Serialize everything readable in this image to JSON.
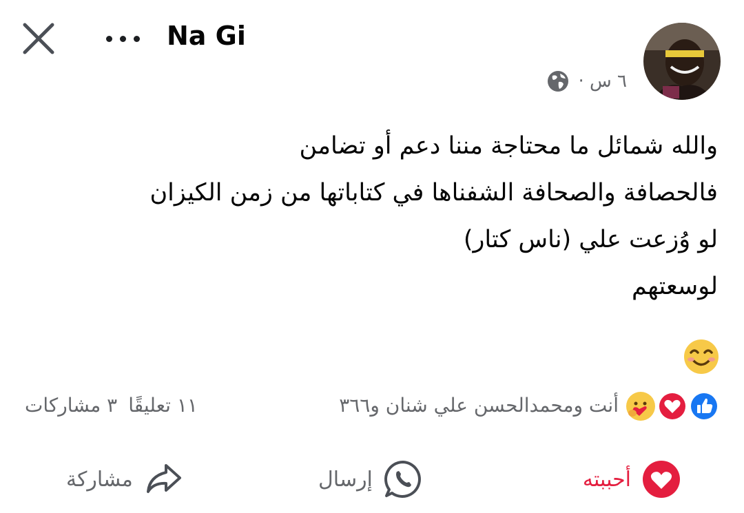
{
  "header": {
    "author_name": "Na Gi",
    "timestamp": "٦ س ·",
    "privacy_icon": "globe-icon",
    "close_icon": "close-icon",
    "more_icon": "more-options-icon"
  },
  "post": {
    "lines": [
      "والله شمائل ما محتاجة مننا دعم أو تضامن",
      "فالحصافة والصحافة الشفناها في كتاباتها من زمن الكيزان",
      "لو وُزعت علي (ناس كتار)",
      "لوسعتهم"
    ],
    "emoji": "smiling-face-icon"
  },
  "reactions": {
    "summary": "أنت ومحمدالحسن علي شنان و٣٦٦",
    "icons": [
      "like-reaction-icon",
      "love-reaction-icon",
      "care-reaction-icon"
    ]
  },
  "counts": {
    "comments": "١١ تعليقًا",
    "shares": "٣ مشاركات"
  },
  "actions": {
    "like_label": "أحببته",
    "send_label": "إرسال",
    "share_label": "مشاركة"
  },
  "colors": {
    "love_red": "#e41e3f",
    "like_blue": "#1877f2",
    "secondary_text": "#65676b"
  }
}
